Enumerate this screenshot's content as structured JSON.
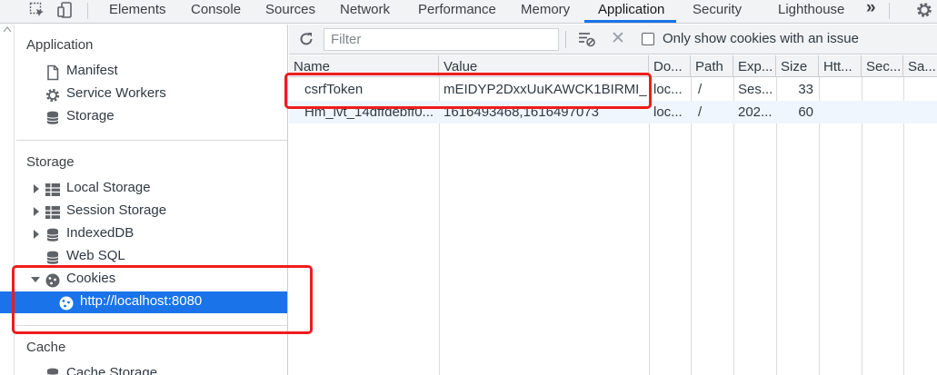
{
  "tabbar": {
    "tabs": [
      {
        "label": "Elements",
        "active": false
      },
      {
        "label": "Console",
        "active": false
      },
      {
        "label": "Sources",
        "active": false
      },
      {
        "label": "Network",
        "active": false
      },
      {
        "label": "Performance",
        "active": false
      },
      {
        "label": "Memory",
        "active": false
      },
      {
        "label": "Application",
        "active": true
      },
      {
        "label": "Security",
        "active": false
      },
      {
        "label": "Lighthouse",
        "active": false
      }
    ],
    "more_label": "»",
    "icons": [
      "inspect-element-icon",
      "device-toolbar-icon",
      "more-tabs-icon",
      "settings-gear-icon"
    ],
    "accent_color": "#1a73e8"
  },
  "sidebar": {
    "application": {
      "title": "Application",
      "items": [
        {
          "label": "Manifest",
          "icon": "document-icon"
        },
        {
          "label": "Service Workers",
          "icon": "gear-icon"
        },
        {
          "label": "Storage",
          "icon": "database-icon"
        }
      ]
    },
    "storage": {
      "title": "Storage",
      "items": [
        {
          "label": "Local Storage",
          "icon": "grid-icon",
          "expandable": true,
          "expanded": false
        },
        {
          "label": "Session Storage",
          "icon": "grid-icon",
          "expandable": true,
          "expanded": false
        },
        {
          "label": "IndexedDB",
          "icon": "database-icon",
          "expandable": true,
          "expanded": false
        },
        {
          "label": "Web SQL",
          "icon": "database-icon",
          "expandable": false
        },
        {
          "label": "Cookies",
          "icon": "cookie-icon",
          "expandable": true,
          "expanded": true
        },
        {
          "label": "http://localhost:8080",
          "icon": "cookie-icon",
          "selected": true
        }
      ]
    },
    "cache": {
      "title": "Cache",
      "items": [
        {
          "label": "Cache Storage",
          "icon": "database-icon"
        }
      ]
    },
    "selected_color": "#1a73e8"
  },
  "toolbar": {
    "filter_placeholder": "Filter",
    "filter_value": "",
    "only_issues_label": "Only show cookies with an issue",
    "only_issues_checked": false,
    "icons": [
      "refresh-icon",
      "clear-filtered-icon",
      "delete-x-icon"
    ]
  },
  "table": {
    "columns": [
      "Name",
      "Value",
      "Do...",
      "Path",
      "Exp...",
      "Size",
      "Htt...",
      "Sec...",
      "Sa..."
    ],
    "rows": [
      {
        "name": "csrfToken",
        "value": "mEIDYP2DxxUuKAWCK1BIRMI_",
        "domain": "loc...",
        "path": "/",
        "expires": "Ses...",
        "size": "33",
        "httponly": "",
        "secure": "",
        "samesite": ""
      },
      {
        "name": "Hm_lvt_14dffdebff0...",
        "value": "1616493468,1616497073",
        "domain": "loc...",
        "path": "/",
        "expires": "202...",
        "size": "60",
        "httponly": "",
        "secure": "",
        "samesite": ""
      }
    ],
    "alt_row_color": "#f0f6fe"
  },
  "annotations": {
    "highlight_color": "#ee1c1c"
  }
}
